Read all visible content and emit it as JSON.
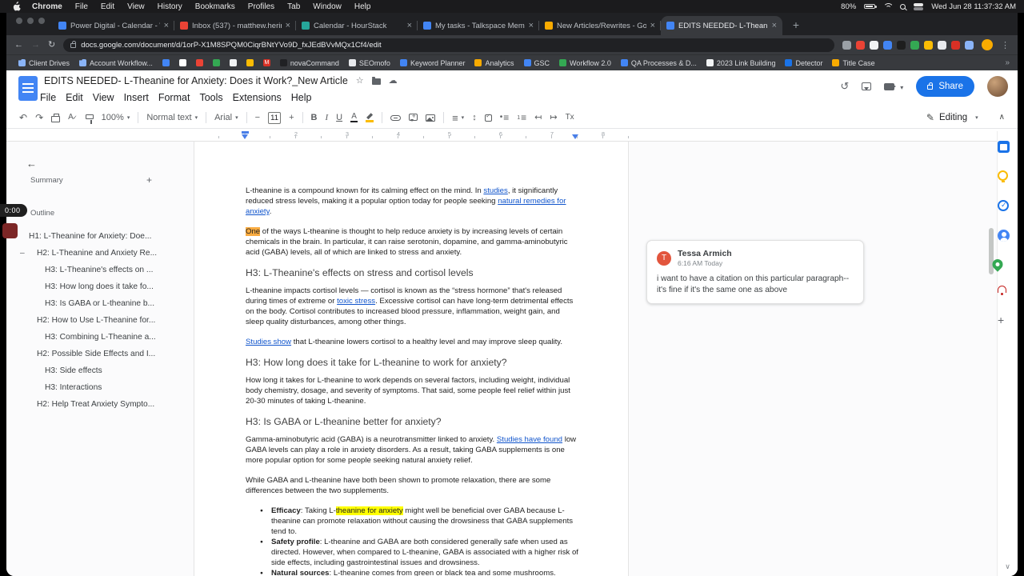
{
  "colors": {
    "accent_blue": "#1a73e8",
    "link": "#1155cc",
    "highlight": "#ffff00",
    "comment_anchor": "#f9ab40",
    "comment_avatar": "#e2553d",
    "share_button": "#1a73e8"
  },
  "menubar": {
    "items": [
      "Chrome",
      "File",
      "Edit",
      "View",
      "History",
      "Bookmarks",
      "Profiles",
      "Tab",
      "Window",
      "Help"
    ],
    "status": {
      "battery": "80%",
      "clock": "Wed Jun 28 11:37:32 AM"
    }
  },
  "browser": {
    "tabs": [
      {
        "title": "Power Digital - Calendar - We...",
        "color": "#4285f4"
      },
      {
        "title": "Inbox (537) - matthew.herin@...",
        "color": "#ea4335"
      },
      {
        "title": "Calendar - HourStack",
        "color": "#26a69a"
      },
      {
        "title": "My tasks - Talkspace Memb...",
        "color": "#4285f4"
      },
      {
        "title": "New Articles/Rewrites - Goog...",
        "color": "#f9ab00"
      },
      {
        "title": "EDITS NEEDED- L-Theanine fo...",
        "color": "#4285f4",
        "active": true
      }
    ],
    "url": "docs.google.com/document/d/1orP-X1M8SPQM0CiqrBNtYVo9D_fxJEdBVvMQx1Cf4/edit",
    "extensions": [
      "#9aa0a6",
      "#ea4335",
      "#f1f3f4",
      "#4285f4",
      "#1e1e1e",
      "#34a853",
      "#fbbc04",
      "#e8eaed",
      "#d93025",
      "#8ab4f8"
    ],
    "bookmarks": [
      {
        "label": "Client Drives",
        "type": "folder"
      },
      {
        "label": "Account Workflow...",
        "type": "folder"
      },
      {
        "color": "#4285f4"
      },
      {
        "color": "#ffffff"
      },
      {
        "color": "#ea4335"
      },
      {
        "color": "#34a853"
      },
      {
        "color": "#f1f3f4"
      },
      {
        "color": "#fbbc04"
      },
      {
        "color": "#d93025",
        "letter": "M"
      },
      {
        "label": "novaCommand",
        "color": "#202124"
      },
      {
        "label": "SEOmofo",
        "color": "#e8eaed"
      },
      {
        "label": "Keyword Planner",
        "color": "#4285f4"
      },
      {
        "label": "Analytics",
        "color": "#f9ab00"
      },
      {
        "label": "GSC",
        "color": "#4285f4"
      },
      {
        "label": "Workflow 2.0",
        "color": "#34a853"
      },
      {
        "label": "QA Processes & D...",
        "color": "#4285f4"
      },
      {
        "label": "2023 Link Building",
        "color": "#f1f3f4"
      },
      {
        "label": "Detector",
        "color": "#1a73e8"
      },
      {
        "label": "Title Case",
        "color": "#f9ab00"
      }
    ]
  },
  "docs": {
    "header": {
      "title": "EDITS NEEDED- L-Theanine for Anxiety: Does it Work?_New Article",
      "share_label": "Share"
    },
    "menus": [
      "File",
      "Edit",
      "View",
      "Insert",
      "Format",
      "Tools",
      "Extensions",
      "Help"
    ],
    "toolbar": {
      "zoom": "100%",
      "style": "Normal text",
      "font": "Arial",
      "font_size": "11",
      "mode": "Editing"
    },
    "ruler_numbers": [
      "1",
      "2",
      "3",
      "4",
      "5",
      "6",
      "7",
      "8"
    ],
    "timer": "0:00",
    "outline": {
      "summary_label": "Summary",
      "outline_label": "Outline",
      "items": [
        {
          "text": "H1: L-Theanine for Anxiety: Doe...",
          "level": 1
        },
        {
          "text": "H2: L-Theanine and Anxiety Re...",
          "level": 2,
          "active": true
        },
        {
          "text": "H3: L-Theanine's effects on ...",
          "level": 3
        },
        {
          "text": "H3: How long does it take fo...",
          "level": 3
        },
        {
          "text": "H3: Is GABA or L-theanine b...",
          "level": 3
        },
        {
          "text": "H2: How to Use L-Theanine for...",
          "level": 2
        },
        {
          "text": "H3: Combining L-Theanine a...",
          "level": 3
        },
        {
          "text": "H2: Possible Side Effects and I...",
          "level": 2
        },
        {
          "text": "H3: Side effects",
          "level": 3
        },
        {
          "text": "H3: Interactions",
          "level": 3
        },
        {
          "text": "H2: Help Treat Anxiety Sympto...",
          "level": 2
        }
      ]
    },
    "comment": {
      "initial": "T",
      "name": "Tessa Armich",
      "time": "6:16 AM Today",
      "text": "i want to have a citation on this particular paragraph-- it's fine if it's the same one as above"
    },
    "document": {
      "blocks": [
        {
          "type": "p",
          "segments": [
            {
              "t": "L-theanine is a compound known for its calming effect on the mind. In "
            },
            {
              "t": "studies",
              "s": "link"
            },
            {
              "t": ", it significantly reduced stress levels, making it a popular option today for people seeking "
            },
            {
              "t": "natural remedies for anxiety",
              "s": "link"
            },
            {
              "t": "."
            }
          ]
        },
        {
          "type": "p",
          "segments": [
            {
              "t": "One",
              "s": "anchor"
            },
            {
              "t": " of the ways L-theanine is thought to help reduce anxiety is by increasing levels of certain chemicals in the brain. In particular, it can raise serotonin, dopamine, and gamma-aminobutyric acid (GABA) levels, all of which are linked to stress and anxiety."
            }
          ]
        },
        {
          "type": "h3",
          "segments": [
            {
              "t": "H3: L-Theanine's effects on stress and cortisol levels"
            }
          ]
        },
        {
          "type": "p",
          "segments": [
            {
              "t": "L-theanine impacts cortisol levels — cortisol is known as the “stress hormone” that's released during times of extreme or "
            },
            {
              "t": "toxic stress",
              "s": "link"
            },
            {
              "t": ". Excessive cortisol can have long-term detrimental effects on the body. Cortisol contributes to increased blood pressure, inflammation, weight gain, and sleep quality disturbances, among other things."
            }
          ]
        },
        {
          "type": "p",
          "segments": [
            {
              "t": "Studies show",
              "s": "link"
            },
            {
              "t": " that L-theanine lowers cortisol to a healthy level and may improve sleep quality."
            }
          ]
        },
        {
          "type": "h3",
          "segments": [
            {
              "t": "H3: How long does it take for L-theanine to work for anxiety?"
            }
          ]
        },
        {
          "type": "p",
          "segments": [
            {
              "t": "How long it takes for L-theanine to work depends on several factors, including weight, individual body chemistry, dosage, and severity of symptoms. That said, some people feel relief within just 20-30 minutes of taking L-theanine."
            }
          ]
        },
        {
          "type": "h3",
          "segments": [
            {
              "t": "H3: Is GABA or L-theanine better for anxiety?"
            }
          ]
        },
        {
          "type": "p",
          "segments": [
            {
              "t": "Gamma-aminobutyric acid (GABA) is a neurotransmitter linked to anxiety. "
            },
            {
              "t": "Studies have found",
              "s": "link"
            },
            {
              "t": " low GABA levels can play a role in anxiety disorders. As a result, taking GABA supplements is one more popular option for some people seeking natural anxiety relief."
            }
          ]
        },
        {
          "type": "p",
          "segments": [
            {
              "t": "While GABA and L-theanine have both been shown to promote relaxation, there are some differences between the two supplements."
            }
          ]
        },
        {
          "type": "li",
          "segments": [
            {
              "t": "Efficacy",
              "s": "bold"
            },
            {
              "t": ": Taking L-"
            },
            {
              "t": "theanine for anxiety",
              "s": "highlight"
            },
            {
              "t": " might well be beneficial over GABA because L-theanine can promote relaxation without causing the drowsiness that GABA supplements tend to."
            }
          ]
        },
        {
          "type": "li",
          "segments": [
            {
              "t": "Safety profile",
              "s": "bold"
            },
            {
              "t": ": L-theanine and GABA are both considered generally safe when used as directed. However, when compared to L-theanine, GABA is associated with a higher risk of side effects, including gastrointestinal issues and drowsiness."
            }
          ]
        },
        {
          "type": "li",
          "segments": [
            {
              "t": "Natural sources",
              "s": "bold"
            },
            {
              "t": ": L-theanine comes from green or black tea and some mushrooms."
            }
          ]
        }
      ]
    }
  }
}
